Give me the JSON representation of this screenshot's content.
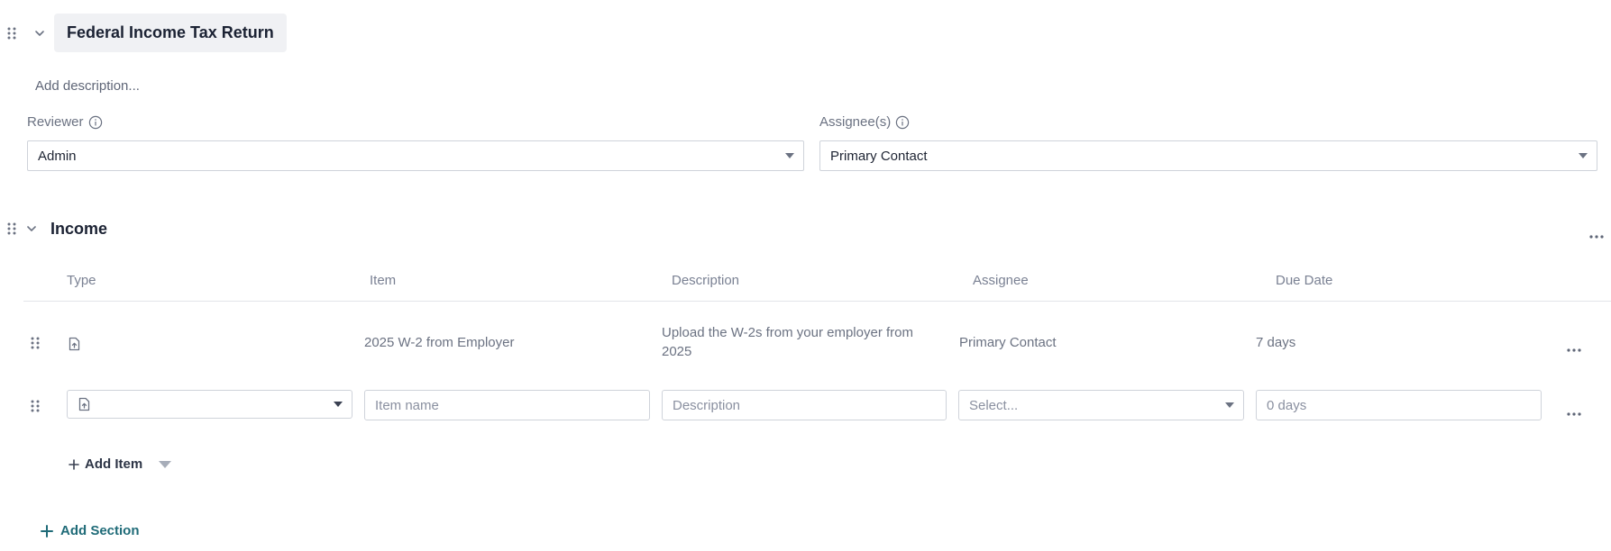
{
  "header": {
    "title": "Federal Income Tax Return",
    "description_placeholder": "Add description..."
  },
  "reviewer": {
    "label": "Reviewer",
    "value": "Admin"
  },
  "assignees": {
    "label": "Assignee(s)",
    "value": "Primary Contact"
  },
  "section": {
    "title": "Income",
    "columns": {
      "type": "Type",
      "item": "Item",
      "description": "Description",
      "assignee": "Assignee",
      "due_date": "Due Date"
    },
    "rows": [
      {
        "type_icon": "file-upload-icon",
        "item": "2025 W-2 from Employer",
        "description": "Upload the W-2s from your employer from 2025",
        "assignee": "Primary Contact",
        "due_date": "7 days"
      }
    ],
    "new_row": {
      "type_icon": "file-upload-icon",
      "item_placeholder": "Item name",
      "description_placeholder": "Description",
      "assignee_placeholder": "Select...",
      "due_placeholder": "0 days"
    },
    "add_item_label": "Add Item"
  },
  "add_section_label": "Add Section",
  "colors": {
    "accent": "#1f6b78",
    "title_bg": "#f0f1f4",
    "border": "#cfd3da"
  }
}
